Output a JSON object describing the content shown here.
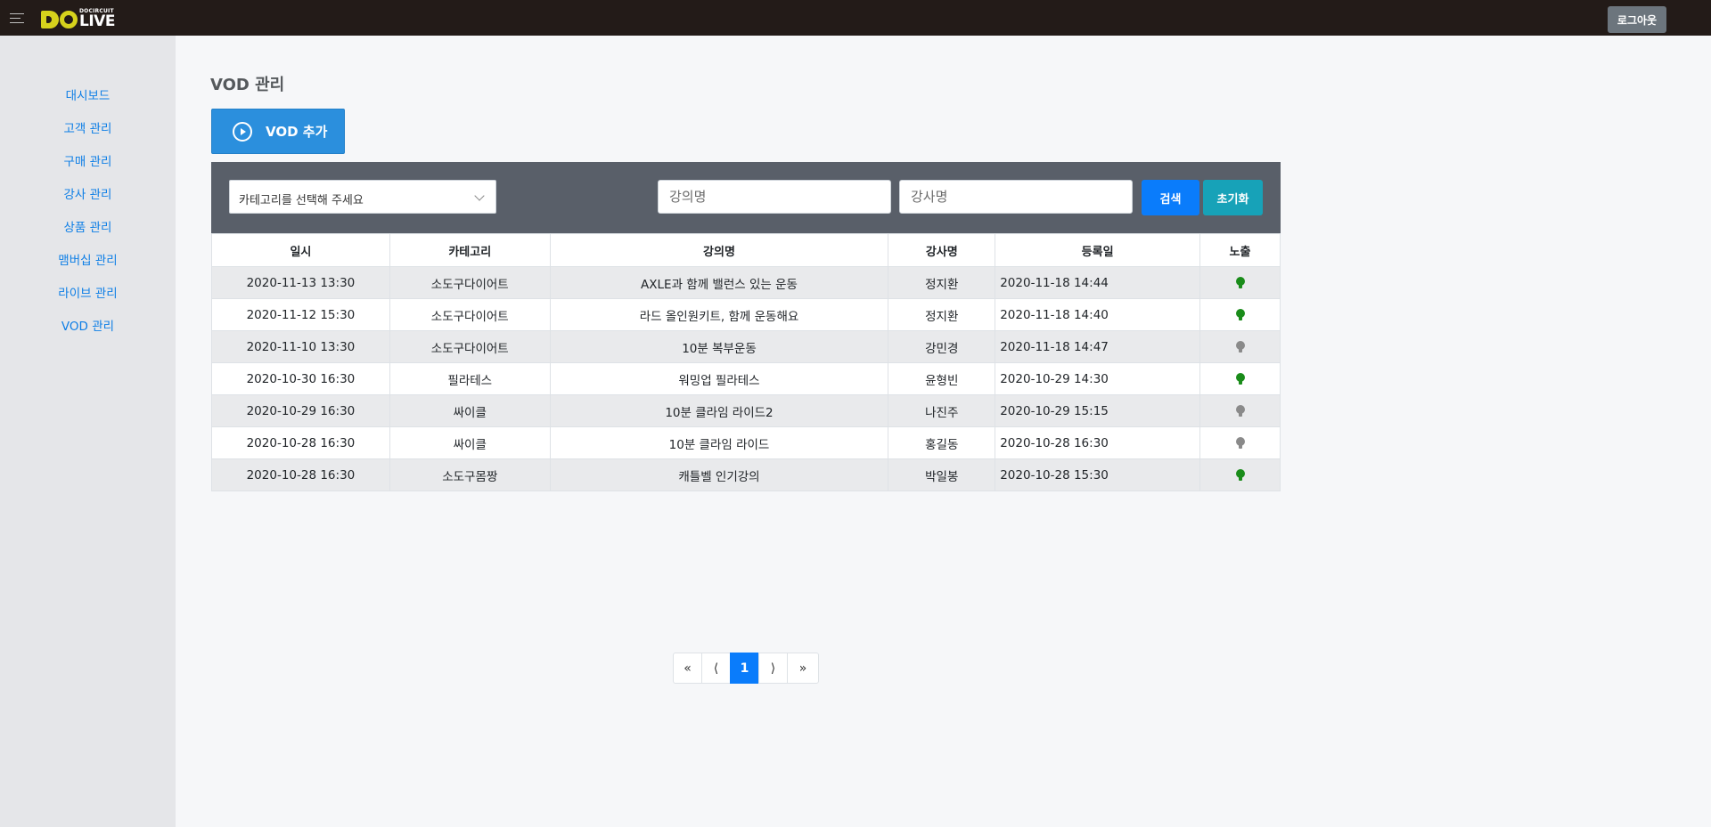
{
  "header": {
    "logo_small": "DOCIRCUIT",
    "logo_big": "LIVE",
    "logout_label": "로그아웃"
  },
  "sidebar": {
    "items": [
      {
        "label": "대시보드"
      },
      {
        "label": "고객 관리"
      },
      {
        "label": "구매 관리"
      },
      {
        "label": "강사 관리"
      },
      {
        "label": "상품 관리"
      },
      {
        "label": "맴버십 관리"
      },
      {
        "label": "라이브 관리"
      },
      {
        "label": "VOD 관리"
      }
    ]
  },
  "main": {
    "title": "VOD 관리",
    "add_button_label": "VOD 추가",
    "filter": {
      "category_select": "카테고리를 선택해 주세요",
      "lecture_placeholder": "강의명",
      "instructor_placeholder": "강사명",
      "search_label": "검색",
      "reset_label": "초기화"
    },
    "table": {
      "headers": [
        "일시",
        "카테고리",
        "강의명",
        "강사명",
        "등록일",
        "노출"
      ],
      "rows": [
        {
          "date": "2020-11-13 13:30",
          "category": "소도구다이어트",
          "lecture": "AXLE과 함께 밸런스 있는 운동",
          "instructor": "정지환",
          "registered": "2020-11-18 14:44",
          "visible": true
        },
        {
          "date": "2020-11-12 15:30",
          "category": "소도구다이어트",
          "lecture": "라드 올인원키트, 함께 운동해요",
          "instructor": "정지환",
          "registered": "2020-11-18 14:40",
          "visible": true
        },
        {
          "date": "2020-11-10 13:30",
          "category": "소도구다이어트",
          "lecture": "10분 복부운동",
          "instructor": "강민경",
          "registered": "2020-11-18 14:47",
          "visible": false
        },
        {
          "date": "2020-10-30 16:30",
          "category": "필라테스",
          "lecture": "워밍업 필라테스",
          "instructor": "윤형빈",
          "registered": "2020-10-29 14:30",
          "visible": true
        },
        {
          "date": "2020-10-29 16:30",
          "category": "싸이클",
          "lecture": "10분 클라임 라이드2",
          "instructor": "나진주",
          "registered": "2020-10-29 15:15",
          "visible": false
        },
        {
          "date": "2020-10-28 16:30",
          "category": "싸이클",
          "lecture": "10분 클라임 라이드",
          "instructor": "홍길동",
          "registered": "2020-10-28 16:30",
          "visible": false
        },
        {
          "date": "2020-10-28 16:30",
          "category": "소도구몸짱",
          "lecture": "캐틀벨 인기강의",
          "instructor": "박일봉",
          "registered": "2020-10-28 15:30",
          "visible": true
        }
      ]
    },
    "pagination": {
      "first": "«",
      "prev": "⟨",
      "current": "1",
      "next": "⟩",
      "last": "»"
    }
  },
  "colors": {
    "visible_on": "#1a8c1a",
    "visible_off": "#8a8a8a",
    "accent": "#0a7cfb"
  }
}
